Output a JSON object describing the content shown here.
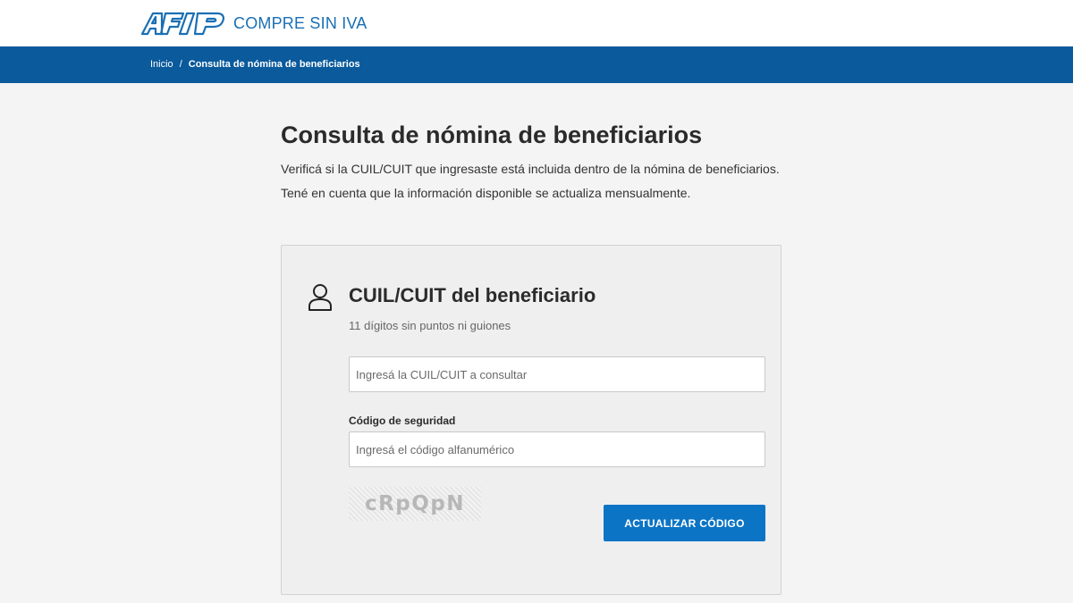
{
  "header": {
    "logo_text": "AFIP",
    "site_title": "COMPRE SIN IVA"
  },
  "breadcrumb": {
    "home": "Inicio",
    "separator": "/",
    "current": "Consulta de nómina de beneficiarios"
  },
  "page": {
    "title": "Consulta de nómina de beneficiarios",
    "description_1": "Verificá si la CUIL/CUIT que ingresaste está incluida dentro de la nómina de beneficiarios.",
    "description_2": "Tené en cuenta que la información disponible se actualiza mensualmente."
  },
  "form": {
    "icon": "user-icon",
    "title": "CUIL/CUIT del beneficiario",
    "subtitle": "11 dígitos sin puntos ni guiones",
    "cuit_placeholder": "Ingresá la CUIL/CUIT a consultar",
    "cuit_value": "",
    "code_label": "Código de seguridad",
    "code_placeholder": "Ingresá el código alfanumérico",
    "code_value": "",
    "captcha_text": "cRpQpN",
    "refresh_button": "ACTUALIZAR CÓDIGO"
  },
  "colors": {
    "brand_blue": "#1a6fb4",
    "breadcrumb_bar": "#0a5a9c",
    "button_blue": "#0b74c5",
    "page_bg": "#f4f4f4",
    "card_bg": "#efefef"
  }
}
